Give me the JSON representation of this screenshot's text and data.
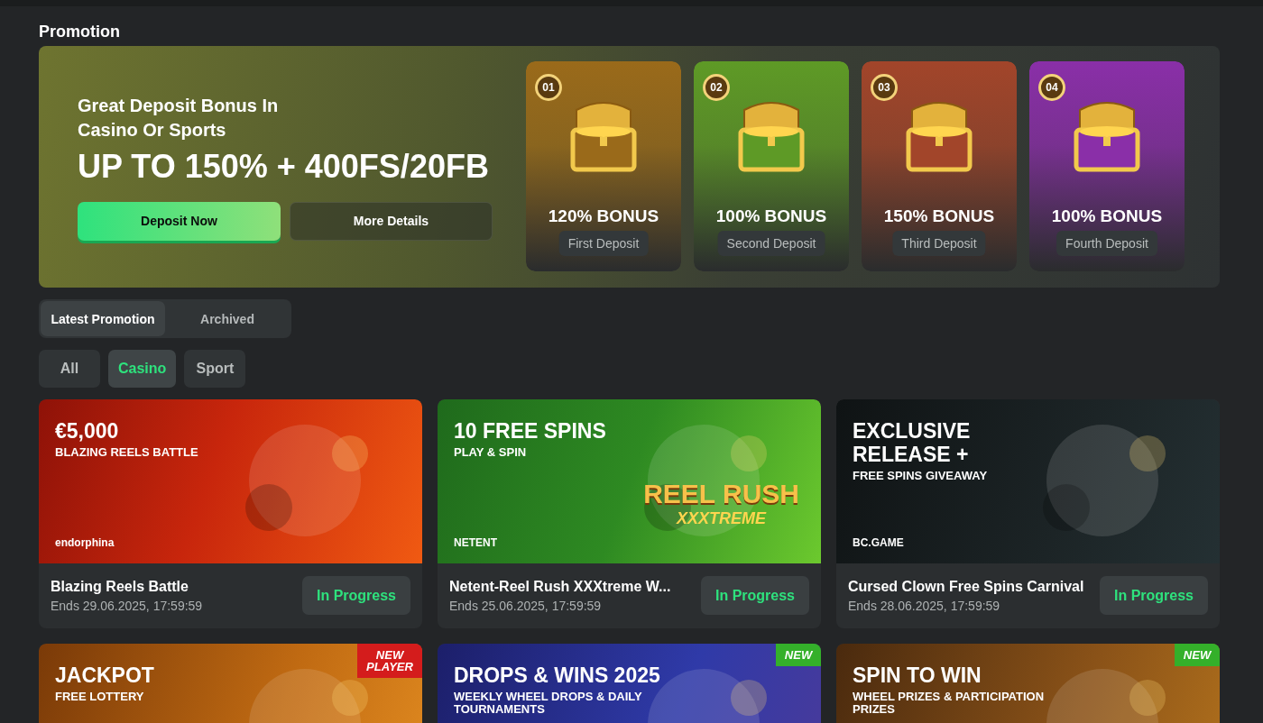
{
  "page_title": "Promotion",
  "hero": {
    "subtitle": "Great Deposit Bonus In Casino Or Sports",
    "headline": "UP TO 150% + 400FS/20FB",
    "buttons": [
      {
        "label": "Deposit Now",
        "kind": "primary"
      },
      {
        "label": "More Details",
        "kind": "secondary"
      }
    ]
  },
  "bonuses": [
    {
      "badge": "01",
      "amount": "120% BONUS",
      "label": "First Deposit",
      "color": "#9a6a1a"
    },
    {
      "badge": "02",
      "amount": "100% BONUS",
      "label": "Second Deposit",
      "color": "#5e9a26"
    },
    {
      "badge": "03",
      "amount": "150% BONUS",
      "label": "Third Deposit",
      "color": "#a2452a"
    },
    {
      "badge": "04",
      "amount": "100% BONUS",
      "label": "Fourth Deposit",
      "color": "#8a2fa8"
    }
  ],
  "tabs": [
    {
      "label": "Latest Promotion",
      "selected": true
    },
    {
      "label": "Archived",
      "selected": false
    }
  ],
  "filters": [
    {
      "label": "All",
      "selected": false
    },
    {
      "label": "Casino",
      "selected": true
    },
    {
      "label": "Sport",
      "selected": false
    }
  ],
  "promotions": [
    {
      "kind": "fire",
      "banner_title": "€5,000",
      "banner_subtitle": "BLAZING REELS BATTLE",
      "brand": "endorphina",
      "name": "Blazing Reels Battle",
      "ends": "Ends 29.06.2025, 17:59:59",
      "status": "In Progress"
    },
    {
      "kind": "jungle",
      "banner_title": "10 FREE SPINS",
      "banner_subtitle": "PLAY & SPIN",
      "game_logo": "REEL RUSH",
      "game_logo_sub": "XXXTREME",
      "brand": "NETENT",
      "name": "Netent-Reel Rush XXXtreme W...",
      "ends": "Ends 25.06.2025, 17:59:59",
      "status": "In Progress"
    },
    {
      "kind": "dark",
      "banner_title": "EXCLUSIVE RELEASE +",
      "banner_subtitle": "FREE SPINS GIVEAWAY",
      "brand": "BC.GAME",
      "name": "Cursed Clown Free Spins Carnival",
      "ends": "Ends 28.06.2025, 17:59:59",
      "status": "In Progress"
    },
    {
      "kind": "amber",
      "ribbon": "NEW PLAYER",
      "banner_title": "JACKPOT",
      "banner_subtitle": "FREE LOTTERY"
    },
    {
      "kind": "royal",
      "ribbon": "NEW",
      "banner_title": "DROPS & WINS 2025",
      "banner_subtitle": "WEEKLY WHEEL DROPS & DAILY TOURNAMENTS"
    },
    {
      "kind": "bronze",
      "ribbon": "NEW",
      "banner_title": "SPIN TO WIN",
      "banner_subtitle": "WHEEL PRIZES & PARTICIPATION PRIZES"
    }
  ]
}
